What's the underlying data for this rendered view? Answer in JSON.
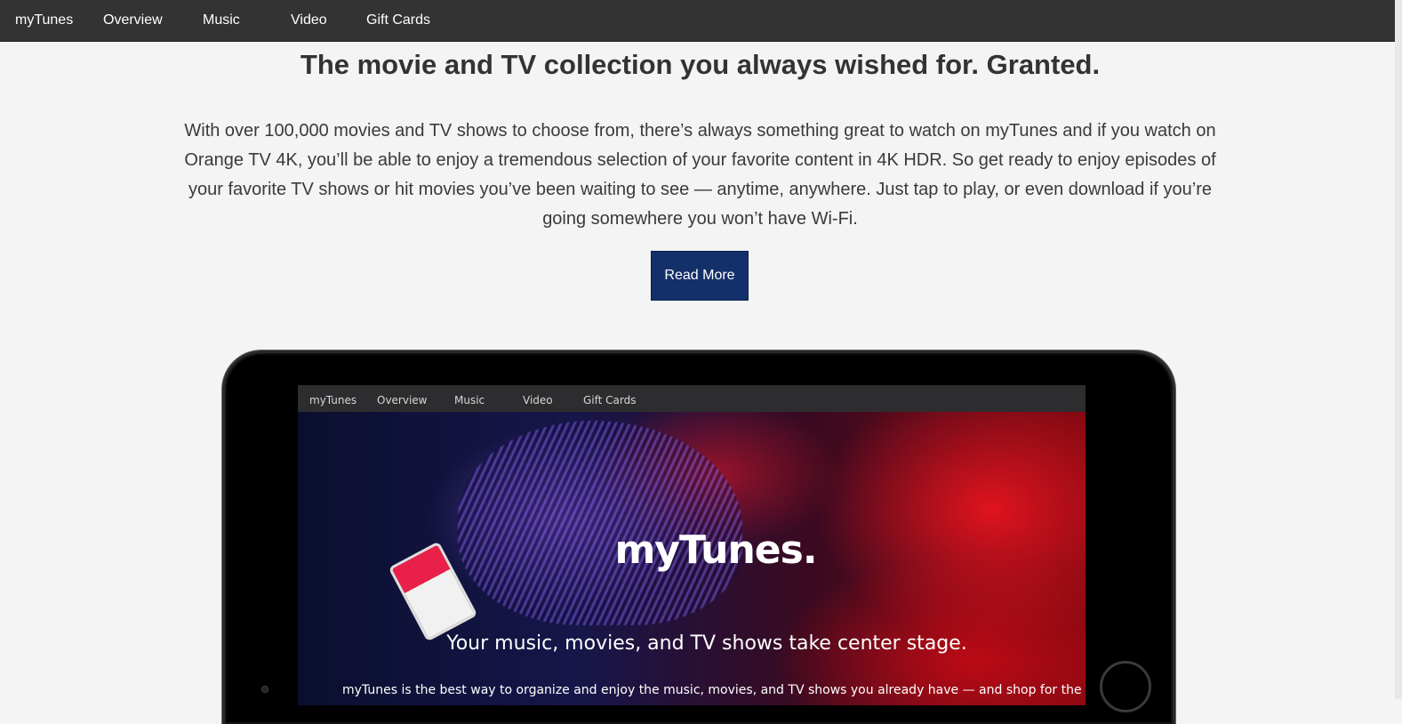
{
  "nav": {
    "items": [
      {
        "label": "myTunes"
      },
      {
        "label": "Overview"
      },
      {
        "label": "Music"
      },
      {
        "label": "Video"
      },
      {
        "label": "Gift Cards"
      }
    ]
  },
  "main": {
    "headline": "The movie and TV collection you always wished for. Granted.",
    "body": "With over 100,000 movies and TV shows to choose from, there’s always something great to watch on myTunes and if you watch on Orange TV 4K, you’ll be able to enjoy a tremendous selection of your favorite content in 4K HDR. So get ready to enjoy episodes of your favorite TV shows or hit movies you’ve been waiting to see — anytime, anywhere. Just tap to play, or even download if you’re going somewhere you won’t have Wi-Fi.",
    "cta_label": "Read More"
  },
  "tablet_screen": {
    "nav": [
      "myTunes",
      "Overview",
      "Music",
      "Video",
      "Gift Cards"
    ],
    "hero_title": "myTunes.",
    "hero_subtitle": "Your music, movies, and TV shows take center stage.",
    "hero_body": "myTunes is the best way to organize and enjoy the music, movies, and TV shows you already have — and shop for the ones you"
  },
  "colors": {
    "nav_bg": "#333333",
    "page_bg": "#f4f4f4",
    "cta_bg": "#14306a",
    "text": "#333333"
  }
}
